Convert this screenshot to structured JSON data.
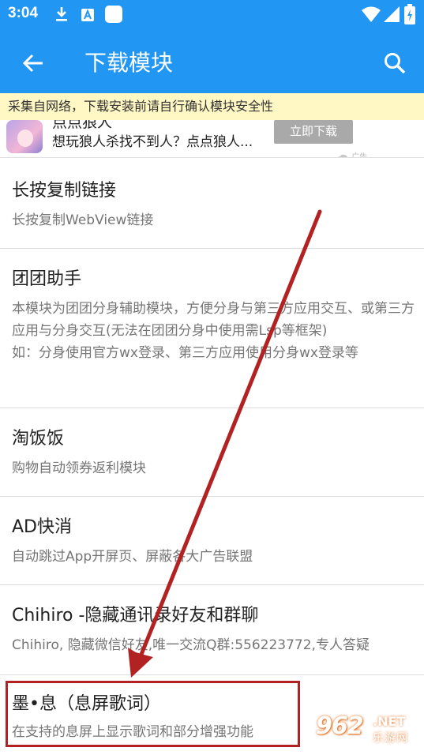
{
  "status_bar": {
    "time": "3:04",
    "icons": [
      "download-icon",
      "a-notification-icon",
      "app-notification-icon",
      "wifi-icon",
      "signal-icon",
      "battery-charging-icon"
    ]
  },
  "app_bar": {
    "title": "下载模块",
    "back_icon": "arrow-left-icon",
    "search_icon": "search-icon"
  },
  "notice": {
    "text": "采集自网络，下载安装前请自行确认模块安全性"
  },
  "ad": {
    "title": "点点狼人",
    "description": "想玩狼人杀找不到人？点点狼人...",
    "button": "立即下载",
    "tag": "广告"
  },
  "modules": [
    {
      "title": "长按复制链接",
      "description": "长按复制WebView链接"
    },
    {
      "title": "团团助手",
      "description": "本模块为团团分身辅助模块，方便分身与第三方应用交互、或第三方应用与分身交互(无法在团团分身中使用需Lsp等框架)\n如：分身使用官方wx登录、第三方应用使用分身wx登录等"
    },
    {
      "title": "淘饭饭",
      "description": "购物自动领券返利模块"
    },
    {
      "title": "AD快消",
      "description": "自动跳过App开屏页、屏蔽各大广告联盟"
    },
    {
      "title": "Chihiro -隐藏通讯录好友和群聊",
      "description": "Chihiro, 隐藏微信好友,唯一交流Q群:556223772,专人答疑"
    },
    {
      "title": "墨•息（息屏歌词）",
      "description": "在支持的息屏上显示歌词和部分增强功能"
    }
  ],
  "watermark": {
    "logo": "962",
    "net": ".NET",
    "name": "乐游网"
  },
  "colors": {
    "primary": "#2196F3",
    "notice_bg": "#FFF8C4",
    "annotation": "#B22222"
  }
}
